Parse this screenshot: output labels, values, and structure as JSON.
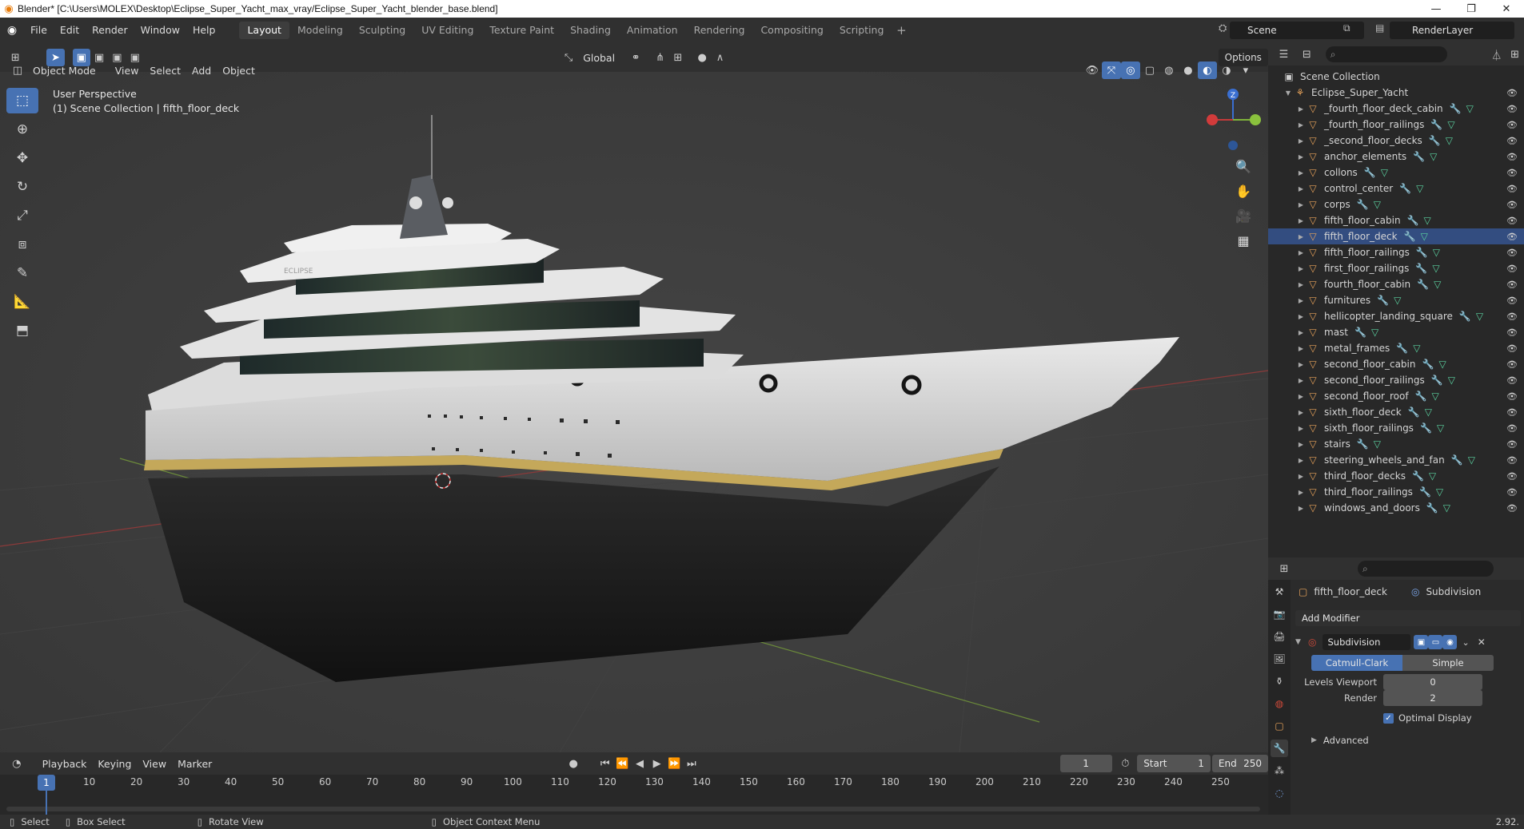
{
  "window": {
    "title": "Blender* [C:\\Users\\MOLEX\\Desktop\\Eclipse_Super_Yacht_max_vray/Eclipse_Super_Yacht_blender_base.blend]"
  },
  "menu": [
    "File",
    "Edit",
    "Render",
    "Window",
    "Help"
  ],
  "workspaces": [
    "Layout",
    "Modeling",
    "Sculpting",
    "UV Editing",
    "Texture Paint",
    "Shading",
    "Animation",
    "Rendering",
    "Compositing",
    "Scripting"
  ],
  "active_workspace": "Layout",
  "scene": {
    "name": "Scene",
    "render_layer": "RenderLayer"
  },
  "viewport": {
    "transform_orientation": "Global",
    "options_label": "Options",
    "mode": "Object Mode",
    "menus": [
      "View",
      "Select",
      "Add",
      "Object"
    ],
    "perspective_label": "User Perspective",
    "collection_label": "(1) Scene Collection | fifth_floor_deck",
    "gizmo_z": "Z",
    "hull_text": "ECLIPSE"
  },
  "timeline": {
    "menus": [
      "Playback",
      "Keying",
      "View",
      "Marker"
    ],
    "current_frame": "1",
    "start_label": "Start",
    "start": "1",
    "end_label": "End",
    "end": "250",
    "ticks": [
      "1",
      "10",
      "20",
      "30",
      "40",
      "50",
      "60",
      "70",
      "80",
      "90",
      "100",
      "110",
      "120",
      "130",
      "140",
      "150",
      "160",
      "170",
      "180",
      "190",
      "200",
      "210",
      "220",
      "230",
      "240",
      "250"
    ]
  },
  "statusbar": {
    "select": "Select",
    "box_select": "Box Select",
    "rotate": "Rotate View",
    "context": "Object Context Menu",
    "version": "2.92."
  },
  "outliner": {
    "root": "Scene Collection",
    "collection": "Eclipse_Super_Yacht",
    "selected": "fifth_floor_deck",
    "items": [
      "_fourth_floor_deck_cabin",
      "_fourth_floor_railings",
      "_second_floor_decks",
      "anchor_elements",
      "collons",
      "control_center",
      "corps",
      "fifth_floor_cabin",
      "fifth_floor_deck",
      "fifth_floor_railings",
      "first_floor_railings",
      "fourth_floor_cabin",
      "furnitures",
      "hellicopter_landing_square",
      "mast",
      "metal_frames",
      "second_floor_cabin",
      "second_floor_railings",
      "second_floor_roof",
      "sixth_floor_deck",
      "sixth_floor_railings",
      "stairs",
      "steering_wheels_and_fan",
      "third_floor_decks",
      "third_floor_railings",
      "windows_and_doors"
    ]
  },
  "properties": {
    "object": "fifth_floor_deck",
    "modifier_tab": "Subdivision",
    "add_modifier": "Add Modifier",
    "modifier_name": "Subdivision",
    "mode_a": "Catmull-Clark",
    "mode_b": "Simple",
    "levels_viewport_label": "Levels Viewport",
    "levels_viewport": "0",
    "render_label": "Render",
    "render": "2",
    "optimal_display": "Optimal Display",
    "advanced": "Advanced"
  },
  "colors": {
    "accent": "#4772b3",
    "object_icon": "#e8a35a",
    "modifier_icon": "#7aa4e6",
    "mesh_icon": "#5bd2a0"
  }
}
